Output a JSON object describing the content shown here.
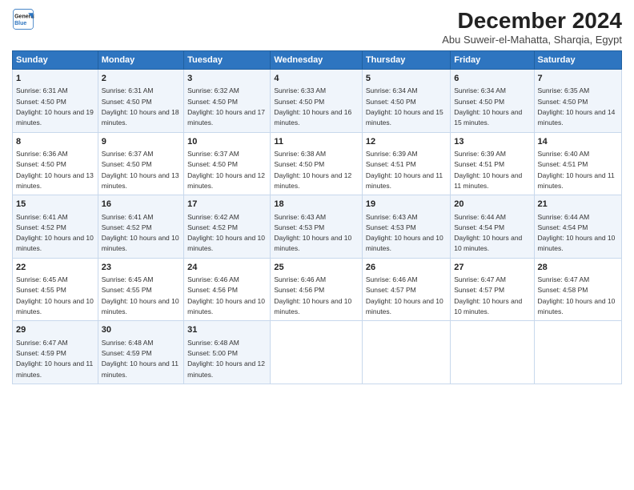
{
  "logo": {
    "line1": "General",
    "line2": "Blue"
  },
  "title": "December 2024",
  "subtitle": "Abu Suweir-el-Mahatta, Sharqia, Egypt",
  "days_header": [
    "Sunday",
    "Monday",
    "Tuesday",
    "Wednesday",
    "Thursday",
    "Friday",
    "Saturday"
  ],
  "weeks": [
    [
      {
        "num": "1",
        "sunrise": "6:31 AM",
        "sunset": "4:50 PM",
        "daylight": "10 hours and 19 minutes."
      },
      {
        "num": "2",
        "sunrise": "6:31 AM",
        "sunset": "4:50 PM",
        "daylight": "10 hours and 18 minutes."
      },
      {
        "num": "3",
        "sunrise": "6:32 AM",
        "sunset": "4:50 PM",
        "daylight": "10 hours and 17 minutes."
      },
      {
        "num": "4",
        "sunrise": "6:33 AM",
        "sunset": "4:50 PM",
        "daylight": "10 hours and 16 minutes."
      },
      {
        "num": "5",
        "sunrise": "6:34 AM",
        "sunset": "4:50 PM",
        "daylight": "10 hours and 15 minutes."
      },
      {
        "num": "6",
        "sunrise": "6:34 AM",
        "sunset": "4:50 PM",
        "daylight": "10 hours and 15 minutes."
      },
      {
        "num": "7",
        "sunrise": "6:35 AM",
        "sunset": "4:50 PM",
        "daylight": "10 hours and 14 minutes."
      }
    ],
    [
      {
        "num": "8",
        "sunrise": "6:36 AM",
        "sunset": "4:50 PM",
        "daylight": "10 hours and 13 minutes."
      },
      {
        "num": "9",
        "sunrise": "6:37 AM",
        "sunset": "4:50 PM",
        "daylight": "10 hours and 13 minutes."
      },
      {
        "num": "10",
        "sunrise": "6:37 AM",
        "sunset": "4:50 PM",
        "daylight": "10 hours and 12 minutes."
      },
      {
        "num": "11",
        "sunrise": "6:38 AM",
        "sunset": "4:50 PM",
        "daylight": "10 hours and 12 minutes."
      },
      {
        "num": "12",
        "sunrise": "6:39 AM",
        "sunset": "4:51 PM",
        "daylight": "10 hours and 11 minutes."
      },
      {
        "num": "13",
        "sunrise": "6:39 AM",
        "sunset": "4:51 PM",
        "daylight": "10 hours and 11 minutes."
      },
      {
        "num": "14",
        "sunrise": "6:40 AM",
        "sunset": "4:51 PM",
        "daylight": "10 hours and 11 minutes."
      }
    ],
    [
      {
        "num": "15",
        "sunrise": "6:41 AM",
        "sunset": "4:52 PM",
        "daylight": "10 hours and 10 minutes."
      },
      {
        "num": "16",
        "sunrise": "6:41 AM",
        "sunset": "4:52 PM",
        "daylight": "10 hours and 10 minutes."
      },
      {
        "num": "17",
        "sunrise": "6:42 AM",
        "sunset": "4:52 PM",
        "daylight": "10 hours and 10 minutes."
      },
      {
        "num": "18",
        "sunrise": "6:43 AM",
        "sunset": "4:53 PM",
        "daylight": "10 hours and 10 minutes."
      },
      {
        "num": "19",
        "sunrise": "6:43 AM",
        "sunset": "4:53 PM",
        "daylight": "10 hours and 10 minutes."
      },
      {
        "num": "20",
        "sunrise": "6:44 AM",
        "sunset": "4:54 PM",
        "daylight": "10 hours and 10 minutes."
      },
      {
        "num": "21",
        "sunrise": "6:44 AM",
        "sunset": "4:54 PM",
        "daylight": "10 hours and 10 minutes."
      }
    ],
    [
      {
        "num": "22",
        "sunrise": "6:45 AM",
        "sunset": "4:55 PM",
        "daylight": "10 hours and 10 minutes."
      },
      {
        "num": "23",
        "sunrise": "6:45 AM",
        "sunset": "4:55 PM",
        "daylight": "10 hours and 10 minutes."
      },
      {
        "num": "24",
        "sunrise": "6:46 AM",
        "sunset": "4:56 PM",
        "daylight": "10 hours and 10 minutes."
      },
      {
        "num": "25",
        "sunrise": "6:46 AM",
        "sunset": "4:56 PM",
        "daylight": "10 hours and 10 minutes."
      },
      {
        "num": "26",
        "sunrise": "6:46 AM",
        "sunset": "4:57 PM",
        "daylight": "10 hours and 10 minutes."
      },
      {
        "num": "27",
        "sunrise": "6:47 AM",
        "sunset": "4:57 PM",
        "daylight": "10 hours and 10 minutes."
      },
      {
        "num": "28",
        "sunrise": "6:47 AM",
        "sunset": "4:58 PM",
        "daylight": "10 hours and 10 minutes."
      }
    ],
    [
      {
        "num": "29",
        "sunrise": "6:47 AM",
        "sunset": "4:59 PM",
        "daylight": "10 hours and 11 minutes."
      },
      {
        "num": "30",
        "sunrise": "6:48 AM",
        "sunset": "4:59 PM",
        "daylight": "10 hours and 11 minutes."
      },
      {
        "num": "31",
        "sunrise": "6:48 AM",
        "sunset": "5:00 PM",
        "daylight": "10 hours and 12 minutes."
      },
      null,
      null,
      null,
      null
    ]
  ]
}
